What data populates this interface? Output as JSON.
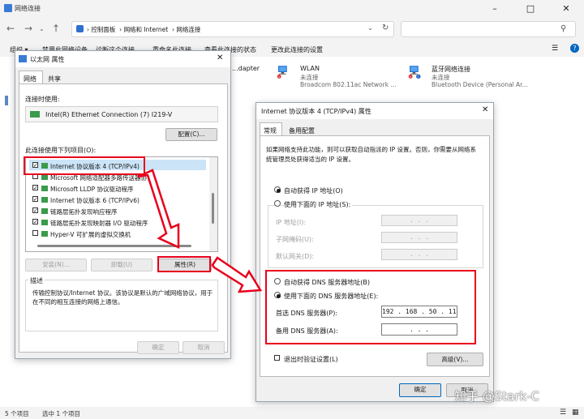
{
  "explorer": {
    "title": "网络连接",
    "breadcrumb": [
      "控制面板",
      "网络和 Internet",
      "网络连接"
    ],
    "search_placeholder": "",
    "commands": [
      "组织 ▾",
      "禁用此网络设备",
      "诊断这个连接",
      "重命名此连接",
      "查看此连接的状态",
      "更改此连接的设置"
    ],
    "adapters": [
      {
        "name": "...dapter",
        "status": "",
        "device": ""
      },
      {
        "name": "WLAN",
        "status": "未连接",
        "device": "Broadcom 802.11ac Network ..."
      },
      {
        "name": "蓝牙网络连接",
        "status": "未连接",
        "device": "Bluetooth Device (Personal Ar..."
      }
    ],
    "status_left": "5 个项目",
    "status_selected": "选中 1 个项目",
    "colors": {
      "accent": "#0067c0",
      "annotation_red": "#e8001c"
    }
  },
  "ethernet_dialog": {
    "title": "以太网 属性",
    "tabs": [
      "网络",
      "共享"
    ],
    "connect_using_label": "连接时使用:",
    "adapter_name": "Intel(R) Ethernet Connection (7) I219-V",
    "configure_button": "配置(C)...",
    "items_label": "此连接使用下列项目(O):",
    "items": [
      {
        "label": "Internet 协议版本 4 (TCP/IPv4)",
        "checked": true
      },
      {
        "label": "Microsoft 网络适配器多路传送器协议",
        "checked": false
      },
      {
        "label": "Microsoft LLDP 协议驱动程序",
        "checked": true
      },
      {
        "label": "Internet 协议版本 6 (TCP/IPv6)",
        "checked": true
      },
      {
        "label": "链路层拓扑发现响应程序",
        "checked": true
      },
      {
        "label": "链路层拓扑发现映射器 I/O 驱动程序",
        "checked": true
      },
      {
        "label": "Hyper-V 可扩展的虚拟交换机",
        "checked": false
      }
    ],
    "install_button": "安装(N)...",
    "uninstall_button": "卸载(U)",
    "properties_button": "属性(R)",
    "description_label": "描述",
    "description_text": "传输控制协议/Internet 协议。该协议是默认的广域网络协议，用于在不同的相互连接的网络上通信。",
    "ok_button": "确定",
    "cancel_button": "取消"
  },
  "ipv4_dialog": {
    "title": "Internet 协议版本 4 (TCP/IPv4) 属性",
    "tabs": [
      "常规",
      "备用配置"
    ],
    "intro": "如果网络支持此功能，则可以获取自动指派的 IP 设置。否则，你需要从网络系统管理员处获得适当的 IP 设置。",
    "auto_ip_label": "自动获得 IP 地址(O)",
    "manual_ip_label": "使用下面的 IP 地址(S):",
    "ip_address_label": "IP 地址(I):",
    "subnet_label": "子网掩码(U):",
    "gateway_label": "默认网关(D):",
    "auto_dns_label": "自动获得 DNS 服务器地址(B)",
    "manual_dns_label": "使用下面的 DNS 服务器地址(E):",
    "preferred_dns_label": "首选 DNS 服务器(P):",
    "preferred_dns_value": "192 . 168 . 50 . 111",
    "alternate_dns_label": "备用 DNS 服务器(A):",
    "alternate_dns_value": ".     .     .",
    "empty_ip_value": ".     .     .",
    "validate_label": "退出时验证设置(L)",
    "advanced_button": "高级(V)...",
    "ok_button": "确定",
    "cancel_button": "取消",
    "selected_ip_mode": "auto",
    "selected_dns_mode": "manual"
  },
  "watermark": "知乎 @Stark-C"
}
